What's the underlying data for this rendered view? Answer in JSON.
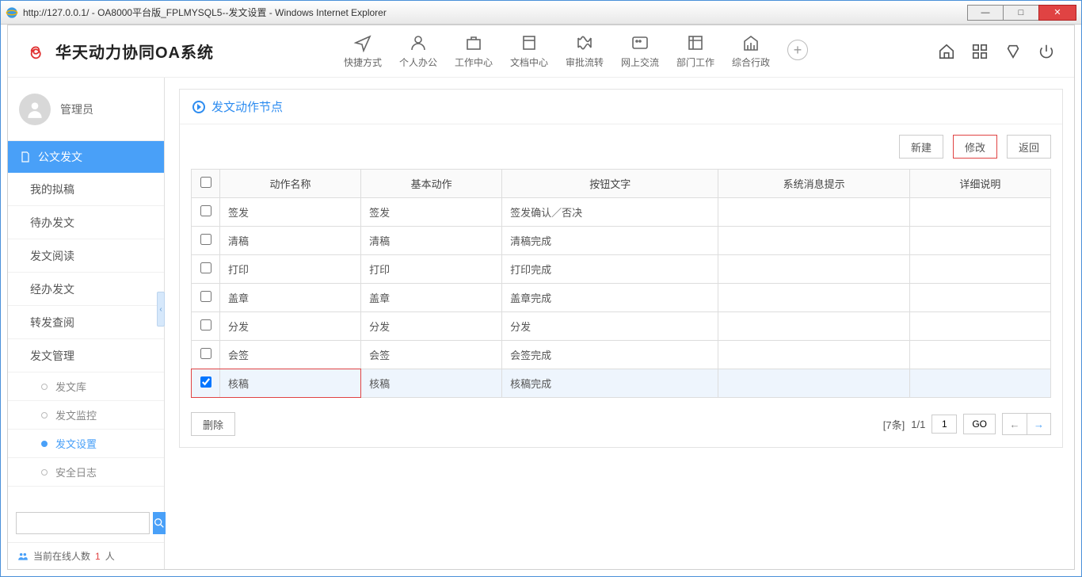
{
  "window": {
    "url": "http://127.0.0.1/",
    "title": " - OA8000平台版_FPLMYSQL5--发文设置 - Windows Internet Explorer"
  },
  "brand": "华天动力协同OA系统",
  "topnav": [
    {
      "label": "快捷方式"
    },
    {
      "label": "个人办公"
    },
    {
      "label": "工作中心"
    },
    {
      "label": "文档中心"
    },
    {
      "label": "审批流转"
    },
    {
      "label": "网上交流"
    },
    {
      "label": "部门工作"
    },
    {
      "label": "综合行政"
    }
  ],
  "user": {
    "name": "管理员"
  },
  "sidebar": {
    "group": "公文发文",
    "items": [
      {
        "label": "我的拟稿"
      },
      {
        "label": "待办发文"
      },
      {
        "label": "发文阅读"
      },
      {
        "label": "经办发文"
      },
      {
        "label": "转发查阅"
      },
      {
        "label": "发文管理"
      }
    ],
    "subitems": [
      {
        "label": "发文库"
      },
      {
        "label": "发文监控"
      },
      {
        "label": "发文设置",
        "active": true
      },
      {
        "label": "安全日志"
      }
    ]
  },
  "online": {
    "prefix": "当前在线人数 ",
    "count": "1",
    "suffix": "人"
  },
  "panel": {
    "title": "发文动作节点"
  },
  "toolbar": {
    "new": "新建",
    "edit": "修改",
    "back": "返回",
    "delete": "删除"
  },
  "table": {
    "headers": [
      "",
      "动作名称",
      "基本动作",
      "按钮文字",
      "系统消息提示",
      "详细说明"
    ],
    "rows": [
      {
        "name": "签发",
        "base": "签发",
        "btn": "签发确认／否决",
        "msg": "",
        "desc": ""
      },
      {
        "name": "清稿",
        "base": "清稿",
        "btn": "清稿完成",
        "msg": "",
        "desc": ""
      },
      {
        "name": "打印",
        "base": "打印",
        "btn": "打印完成",
        "msg": "",
        "desc": ""
      },
      {
        "name": "盖章",
        "base": "盖章",
        "btn": "盖章完成",
        "msg": "",
        "desc": ""
      },
      {
        "name": "分发",
        "base": "分发",
        "btn": "分发",
        "msg": "",
        "desc": ""
      },
      {
        "name": "会签",
        "base": "会签",
        "btn": "会签完成",
        "msg": "",
        "desc": ""
      },
      {
        "name": "核稿",
        "base": "核稿",
        "btn": "核稿完成",
        "msg": "",
        "desc": "",
        "selected": true
      }
    ]
  },
  "pager": {
    "total": "[7条]",
    "page": "1/1",
    "input": "1",
    "go": "GO"
  }
}
